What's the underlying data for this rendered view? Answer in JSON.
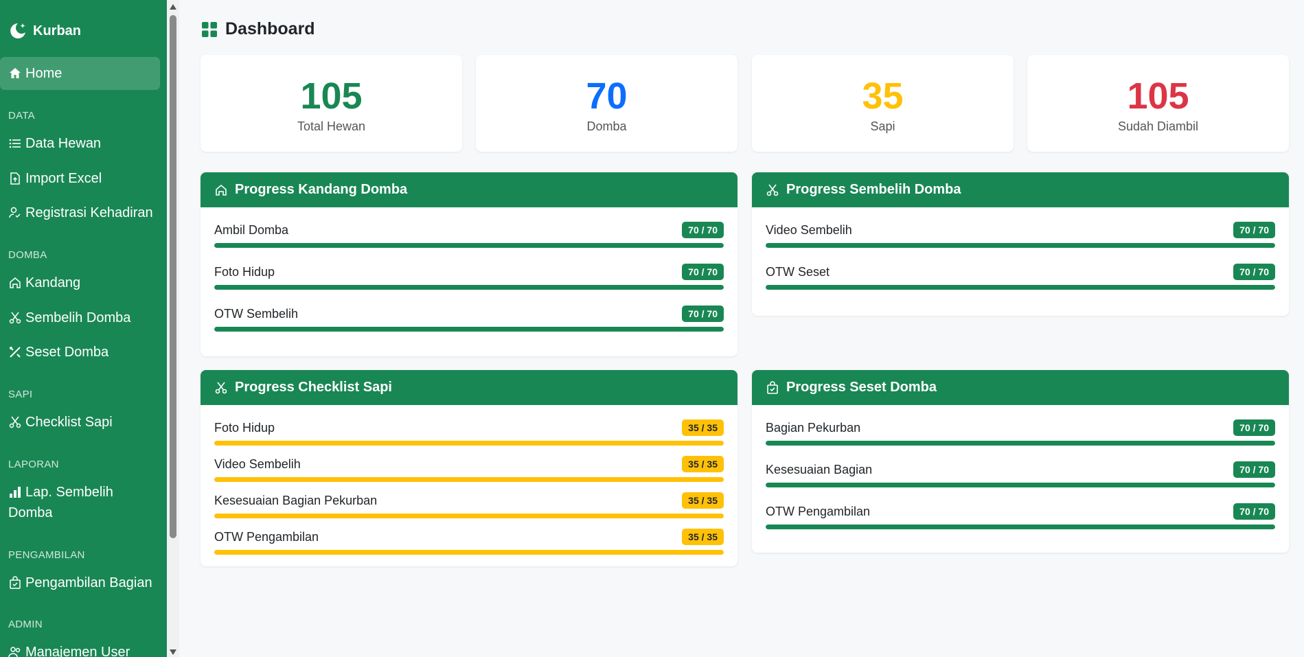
{
  "brand": {
    "name": "Kurban"
  },
  "sidebar": {
    "home": "Home",
    "sections": {
      "data": "DATA",
      "domba": "DOMBA",
      "sapi": "SAPI",
      "laporan": "LAPORAN",
      "pengambilan": "PENGAMBILAN",
      "admin": "ADMIN"
    },
    "items": {
      "data_hewan": "Data Hewan",
      "import_excel": "Import Excel",
      "registrasi": "Registrasi Kehadiran",
      "kandang": "Kandang",
      "sembelih_domba": "Sembelih Domba",
      "seset_domba": "Seset Domba",
      "checklist_sapi": "Checklist Sapi",
      "lap_sembelih_1": "Lap. Sembelih",
      "lap_sembelih_2": "Domba",
      "pengambilan_bagian": "Pengambilan Bagian",
      "manajemen_user": "Manajemen User"
    }
  },
  "page": {
    "title": "Dashboard"
  },
  "stats": [
    {
      "value": "105",
      "label": "Total Hewan",
      "color": "#198754"
    },
    {
      "value": "70",
      "label": "Domba",
      "color": "#0d6efd"
    },
    {
      "value": "35",
      "label": "Sapi",
      "color": "#ffc107"
    },
    {
      "value": "105",
      "label": "Sudah Diambil",
      "color": "#dc3545"
    }
  ],
  "cards": {
    "kandang": {
      "title": "Progress Kandang Domba",
      "rows": [
        {
          "label": "Ambil Domba",
          "badge": "70 / 70",
          "progress": 1.0
        },
        {
          "label": "Foto Hidup",
          "badge": "70 / 70",
          "progress": 1.0
        },
        {
          "label": "OTW Sembelih",
          "badge": "70 / 70",
          "progress": 1.0
        }
      ]
    },
    "sembelih": {
      "title": "Progress Sembelih Domba",
      "rows": [
        {
          "label": "Video Sembelih",
          "badge": "70 / 70",
          "progress": 1.0
        },
        {
          "label": "OTW Seset",
          "badge": "70 / 70",
          "progress": 1.0
        }
      ]
    },
    "sapi": {
      "title": "Progress Checklist Sapi",
      "rows": [
        {
          "label": "Foto Hidup",
          "badge": "35 / 35",
          "progress": 1.0
        },
        {
          "label": "Video Sembelih",
          "badge": "35 / 35",
          "progress": 1.0
        },
        {
          "label": "Kesesuaian Bagian Pekurban",
          "badge": "35 / 35",
          "progress": 1.0
        },
        {
          "label": "OTW Pengambilan",
          "badge": "35 / 35",
          "progress": 1.0
        }
      ]
    },
    "seset": {
      "title": "Progress Seset Domba",
      "rows": [
        {
          "label": "Bagian Pekurban",
          "badge": "70 / 70",
          "progress": 1.0
        },
        {
          "label": "Kesesuaian Bagian",
          "badge": "70 / 70",
          "progress": 1.0
        },
        {
          "label": "OTW Pengambilan",
          "badge": "70 / 70",
          "progress": 1.0
        }
      ]
    }
  },
  "colors": {
    "primary": "#198754",
    "warning": "#ffc107",
    "info": "#0d6efd",
    "danger": "#dc3545"
  }
}
